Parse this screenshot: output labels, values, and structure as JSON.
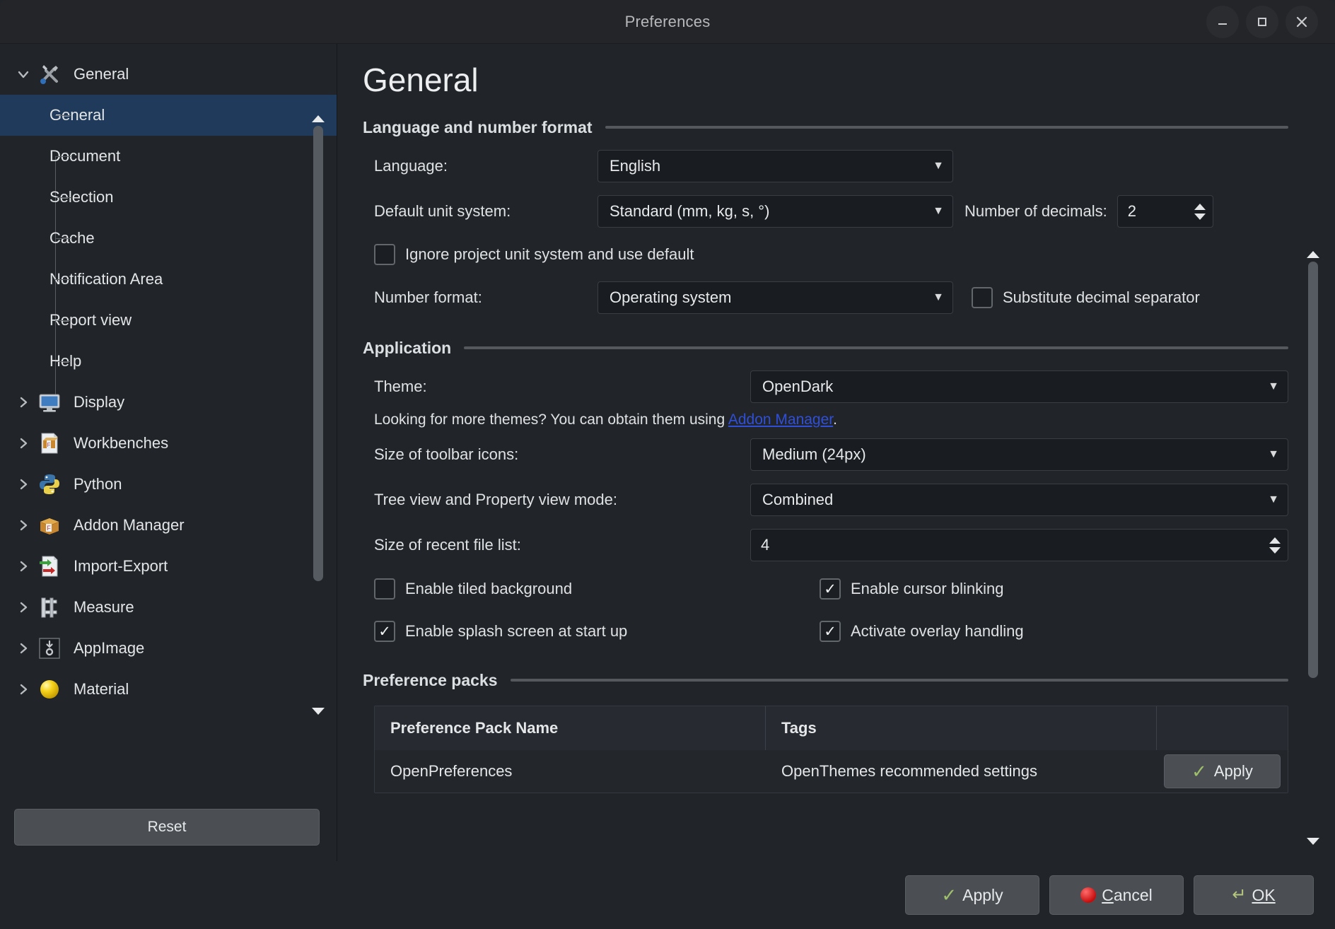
{
  "window": {
    "title": "Preferences",
    "minimize_label": "minimize",
    "maximize_label": "maximize",
    "close_label": "close"
  },
  "sidebar": {
    "items": [
      {
        "label": "General",
        "icon": "tools-icon",
        "level": 0,
        "expanded": true,
        "selected": false
      },
      {
        "label": "General",
        "icon": "",
        "level": 1,
        "expanded": false,
        "selected": true
      },
      {
        "label": "Document",
        "icon": "",
        "level": 1,
        "expanded": false,
        "selected": false
      },
      {
        "label": "Selection",
        "icon": "",
        "level": 1,
        "expanded": false,
        "selected": false
      },
      {
        "label": "Cache",
        "icon": "",
        "level": 1,
        "expanded": false,
        "selected": false
      },
      {
        "label": "Notification Area",
        "icon": "",
        "level": 1,
        "expanded": false,
        "selected": false
      },
      {
        "label": "Report view",
        "icon": "",
        "level": 1,
        "expanded": false,
        "selected": false
      },
      {
        "label": "Help",
        "icon": "",
        "level": 1,
        "expanded": false,
        "selected": false
      },
      {
        "label": "Display",
        "icon": "monitor-icon",
        "level": 0,
        "expanded": false,
        "selected": false
      },
      {
        "label": "Workbenches",
        "icon": "workbenches-icon",
        "level": 0,
        "expanded": false,
        "selected": false
      },
      {
        "label": "Python",
        "icon": "python-icon",
        "level": 0,
        "expanded": false,
        "selected": false
      },
      {
        "label": "Addon Manager",
        "icon": "package-icon",
        "level": 0,
        "expanded": false,
        "selected": false
      },
      {
        "label": "Import-Export",
        "icon": "import-export-icon",
        "level": 0,
        "expanded": false,
        "selected": false
      },
      {
        "label": "Measure",
        "icon": "caliper-icon",
        "level": 0,
        "expanded": false,
        "selected": false
      },
      {
        "label": "AppImage",
        "icon": "appimage-icon",
        "level": 0,
        "expanded": false,
        "selected": false
      },
      {
        "label": "Material",
        "icon": "sphere-icon",
        "level": 0,
        "expanded": false,
        "selected": false
      }
    ],
    "reset_label": "Reset"
  },
  "main": {
    "page_title": "General",
    "sections": {
      "language": {
        "title": "Language and number format",
        "language_label": "Language:",
        "language_value": "English",
        "unit_label": "Default unit system:",
        "unit_value": "Standard (mm, kg, s, °)",
        "decimals_label": "Number of decimals:",
        "decimals_value": "2",
        "ignore_unit_label": "Ignore project unit system and use default",
        "ignore_unit_checked": false,
        "number_format_label": "Number format:",
        "number_format_value": "Operating system",
        "substitute_label": "Substitute decimal separator",
        "substitute_checked": false
      },
      "application": {
        "title": "Application",
        "theme_label": "Theme:",
        "theme_value": "OpenDark",
        "hint_prefix": "Looking for more themes? You can obtain them using ",
        "hint_link": "Addon Manager",
        "hint_suffix": ".",
        "toolbar_icons_label": "Size of toolbar icons:",
        "toolbar_icons_value": "Medium (24px)",
        "treeview_label": "Tree view and Property view mode:",
        "treeview_value": "Combined",
        "recent_files_label": "Size of recent file list:",
        "recent_files_value": "4",
        "tiled_bg_label": "Enable tiled background",
        "tiled_bg_checked": false,
        "cursor_blink_label": "Enable cursor blinking",
        "cursor_blink_checked": true,
        "splash_label": "Enable splash screen at start up",
        "splash_checked": true,
        "overlay_label": "Activate overlay handling",
        "overlay_checked": true
      },
      "preference_packs": {
        "title": "Preference packs",
        "columns": [
          "Preference Pack Name",
          "Tags",
          ""
        ],
        "rows": [
          {
            "name": "OpenPreferences",
            "tags": "OpenThemes recommended settings",
            "action": "Apply"
          }
        ]
      }
    }
  },
  "footer": {
    "apply_label": "Apply",
    "cancel_label": "Cancel",
    "cancel_mnemonic": "C",
    "ok_label": "OK",
    "ok_mnemonic": "O"
  },
  "colors": {
    "selection": "#1f3a5a",
    "link": "#2f4fd8",
    "check_green": "#9fc06a",
    "cancel_red": "#c60d0d",
    "window_bg": "#212429"
  }
}
